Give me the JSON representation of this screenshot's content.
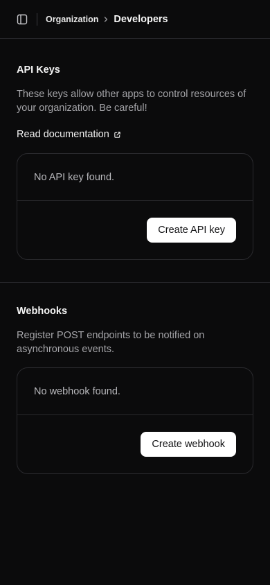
{
  "topbar": {
    "toggle_icon": "sidebar-panel-icon",
    "breadcrumb": [
      "Organization",
      "Developers"
    ]
  },
  "api_keys": {
    "title": "API Keys",
    "description": "These keys allow other apps to control resources of your organization. Be careful!",
    "doc_link": "Read documentation",
    "doc_link_icon": "external-link-icon",
    "empty_text": "No API key found.",
    "button_label": "Create API key"
  },
  "webhooks": {
    "title": "Webhooks",
    "description": "Register POST endpoints to be notified on asynchronous events.",
    "empty_text": "No webhook found.",
    "button_label": "Create webhook"
  },
  "colors": {
    "background": "#0b0b0c",
    "divider": "#26262a",
    "muted_text": "#a4a4a8",
    "button_bg": "#ffffff",
    "button_text": "#111113"
  }
}
